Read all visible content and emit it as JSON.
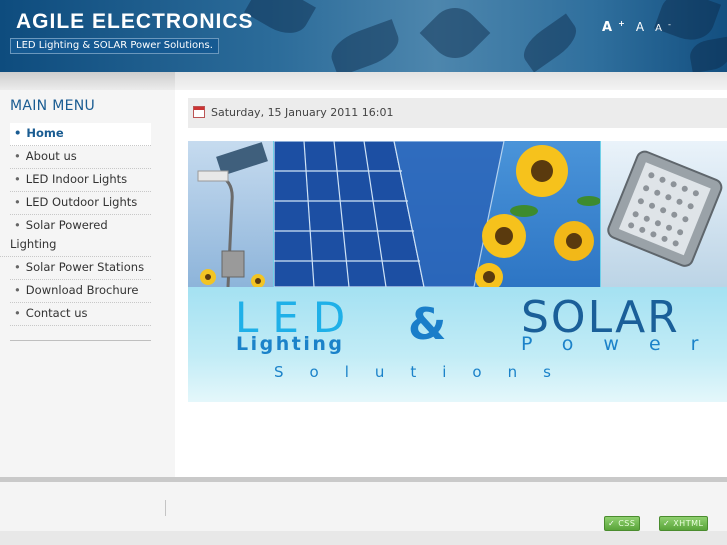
{
  "header": {
    "site_title": "AGILE ELECTRONICS",
    "slogan": "LED Lighting & SOLAR Power Solutions.",
    "font_controls": {
      "larger": "A",
      "larger_sup": "+",
      "reset": "A",
      "smaller": "A",
      "smaller_sup": "-"
    }
  },
  "sidebar": {
    "menu_title": "MAIN MENU",
    "items": [
      {
        "label": "Home",
        "active": true
      },
      {
        "label": "About us"
      },
      {
        "label": "LED Indoor Lights"
      },
      {
        "label": "LED Outdoor Lights"
      },
      {
        "label": "Solar Powered Lighting"
      },
      {
        "label": "Solar Power Stations"
      },
      {
        "label": "Download Brochure"
      },
      {
        "label": "Contact us"
      }
    ]
  },
  "content": {
    "date": "Saturday, 15 January 2011 16:01",
    "banner": {
      "led": "LED",
      "ampersand": "&",
      "solar": "SOLAR",
      "lighting": "Lighting",
      "power": "Power",
      "solutions": "Solutions"
    }
  },
  "footer": {
    "css_badge": "CSS",
    "xhtml_badge": "XHTML"
  },
  "colors": {
    "header_blue": "#1a5c92",
    "menu_title": "#1a5c92",
    "banner_light_blue": "#1fb0e8",
    "badge_green": "#5aa43a"
  },
  "icons": [
    "calendar-icon",
    "check-icon"
  ]
}
